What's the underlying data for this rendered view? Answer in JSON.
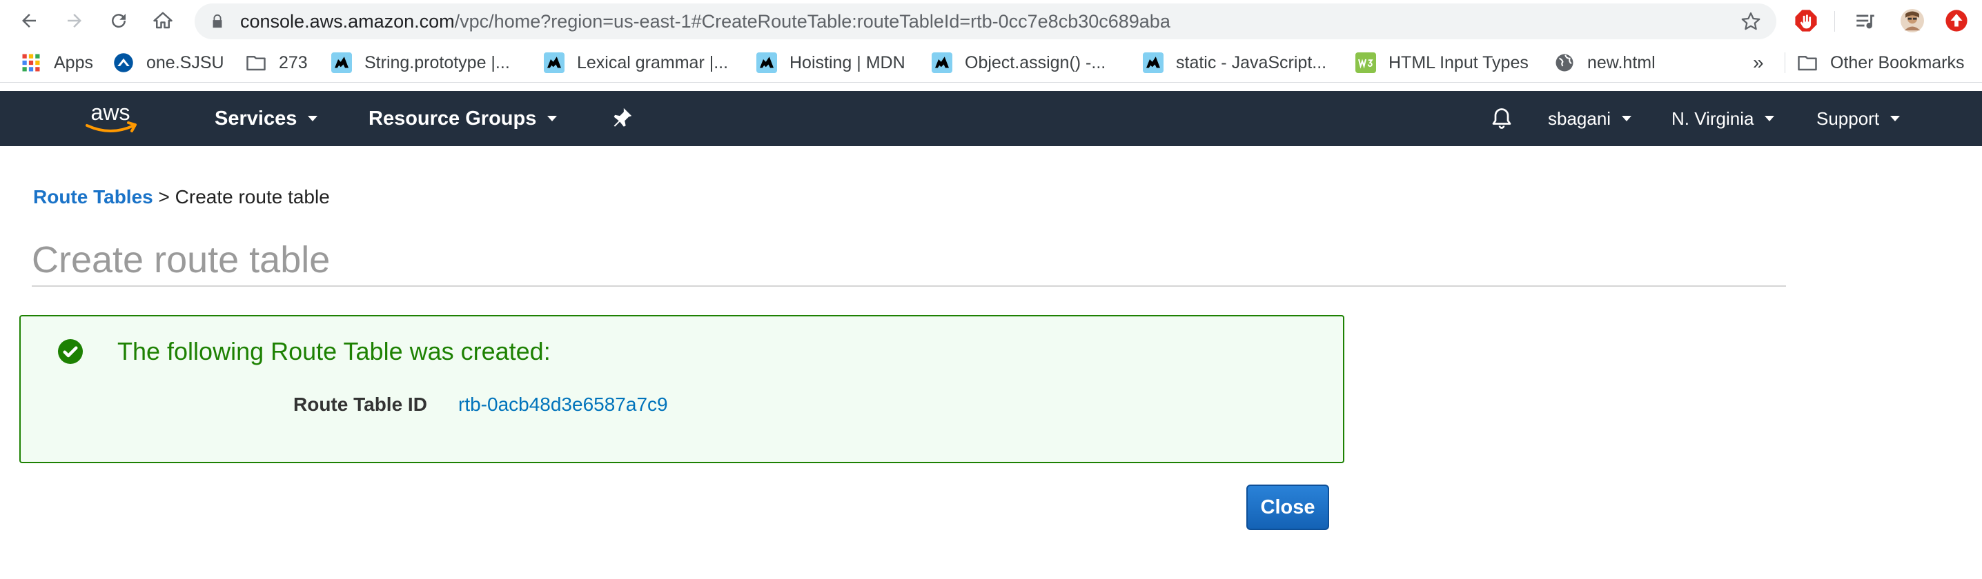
{
  "browser": {
    "url_host": "console.aws.amazon.com",
    "url_path": "/vpc/home?region=us-east-1#CreateRouteTable:routeTableId=rtb-0cc7e8cb30c689aba"
  },
  "bookmarks": {
    "items": [
      {
        "label": "Apps",
        "icon": "apps-grid-icon"
      },
      {
        "label": "one.SJSU",
        "icon": "sjsu-icon"
      },
      {
        "label": "273",
        "icon": "folder-icon"
      },
      {
        "label": "String.prototype |...",
        "icon": "mdn-icon"
      },
      {
        "label": "Lexical grammar |...",
        "icon": "mdn-icon"
      },
      {
        "label": "Hoisting | MDN",
        "icon": "mdn-icon"
      },
      {
        "label": "Object.assign() -...",
        "icon": "mdn-icon"
      },
      {
        "label": "static - JavaScript...",
        "icon": "mdn-icon"
      },
      {
        "label": "HTML Input Types",
        "icon": "w3schools-icon"
      },
      {
        "label": "new.html",
        "icon": "globe-icon"
      }
    ],
    "more": "»",
    "other": "Other Bookmarks"
  },
  "aws_nav": {
    "services": "Services",
    "resource_groups": "Resource Groups",
    "user": "sbagani",
    "region": "N. Virginia",
    "support": "Support"
  },
  "breadcrumb": {
    "parent": "Route Tables",
    "separator": ">",
    "current": "Create route table"
  },
  "page": {
    "title": "Create route table"
  },
  "success": {
    "message": "The following Route Table was created:",
    "label": "Route Table ID",
    "value": "rtb-0acb48d3e6587a7c9"
  },
  "actions": {
    "close": "Close"
  },
  "colors": {
    "aws_nav_bg": "#232f3e",
    "link_blue": "#1a73c8",
    "success_green": "#1d8102",
    "success_bg": "#f2fcf3",
    "button_blue": "#1462b5"
  }
}
